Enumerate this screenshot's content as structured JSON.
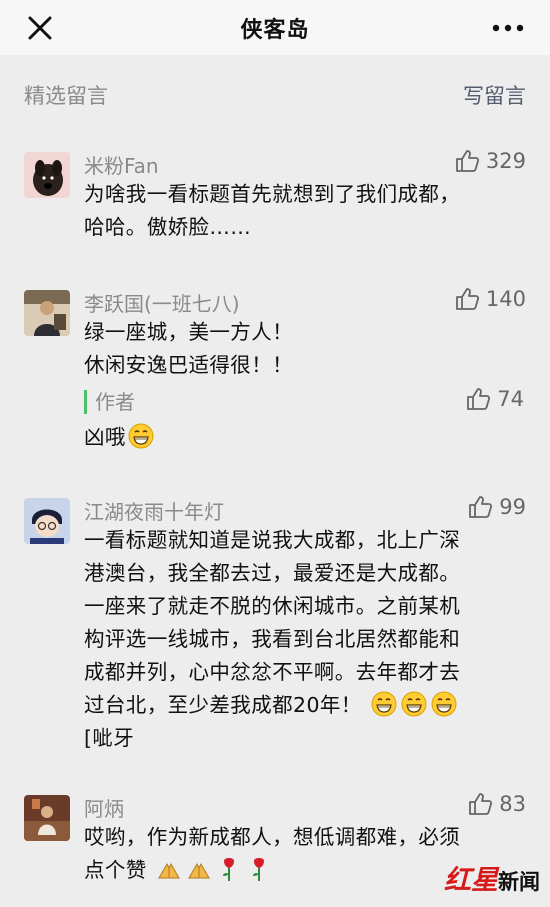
{
  "header": {
    "title": "侠客岛",
    "close_icon": "close-icon",
    "more_icon": "more-icon"
  },
  "section": {
    "title": "精选留言",
    "write_label": "写留言"
  },
  "comments": [
    {
      "name": "米粉Fan",
      "likes": "329",
      "lines": [
        "为啥我一看标题首先就想到了我们成都，",
        "哈哈。傲娇脸……"
      ]
    },
    {
      "name": "李跃国(一班七八)",
      "likes": "140",
      "lines": [
        "绿一座城，美一方人！",
        "休闲安逸巴适得很！！"
      ],
      "reply": {
        "tag": "作者",
        "likes": "74",
        "text": "凶哦"
      }
    },
    {
      "name": "江湖夜雨十年灯",
      "likes": "99",
      "lines": [
        "一看标题就知道是说我大成都，北上广深",
        "港澳台，我全都去过，最爱还是大成都。",
        "一座来了就走不脱的休闲城市。之前某机",
        "构评选一线城市，我看到台北居然都能和",
        "成都并列，心中忿忿不平啊。去年都才去",
        "过台北，至少差我成都20年！",
        "[呲牙"
      ]
    },
    {
      "name": "阿炳",
      "likes": "83",
      "lines": [
        "哎哟，作为新成都人，想低调都难，必须",
        "点个赞"
      ]
    }
  ],
  "watermark": {
    "red": "红星",
    "black": "新闻"
  },
  "colors": {
    "accent_green": "#4cc26a",
    "watermark_red": "#d61a1a",
    "background": "#ededed"
  }
}
